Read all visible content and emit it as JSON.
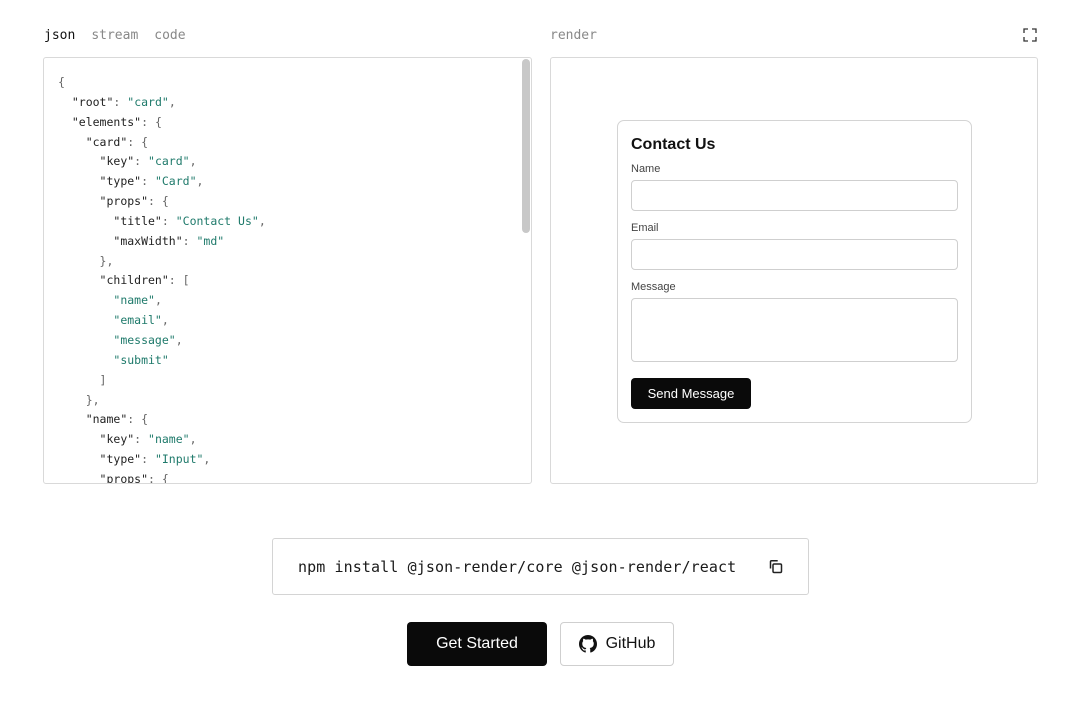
{
  "tabs": [
    {
      "label": "json",
      "active": true
    },
    {
      "label": "stream",
      "active": false
    },
    {
      "label": "code",
      "active": false
    }
  ],
  "render_label": "render",
  "json_lines": [
    [
      [
        "p",
        "{"
      ]
    ],
    [
      [
        "p",
        "  "
      ],
      [
        "k",
        "\"root\""
      ],
      [
        "p",
        ": "
      ],
      [
        "s",
        "\"card\""
      ],
      [
        "p",
        ","
      ]
    ],
    [
      [
        "p",
        "  "
      ],
      [
        "k",
        "\"elements\""
      ],
      [
        "p",
        ": {"
      ]
    ],
    [
      [
        "p",
        "    "
      ],
      [
        "k",
        "\"card\""
      ],
      [
        "p",
        ": {"
      ]
    ],
    [
      [
        "p",
        "      "
      ],
      [
        "k",
        "\"key\""
      ],
      [
        "p",
        ": "
      ],
      [
        "s",
        "\"card\""
      ],
      [
        "p",
        ","
      ]
    ],
    [
      [
        "p",
        "      "
      ],
      [
        "k",
        "\"type\""
      ],
      [
        "p",
        ": "
      ],
      [
        "s",
        "\"Card\""
      ],
      [
        "p",
        ","
      ]
    ],
    [
      [
        "p",
        "      "
      ],
      [
        "k",
        "\"props\""
      ],
      [
        "p",
        ": {"
      ]
    ],
    [
      [
        "p",
        "        "
      ],
      [
        "k",
        "\"title\""
      ],
      [
        "p",
        ": "
      ],
      [
        "s",
        "\"Contact Us\""
      ],
      [
        "p",
        ","
      ]
    ],
    [
      [
        "p",
        "        "
      ],
      [
        "k",
        "\"maxWidth\""
      ],
      [
        "p",
        ": "
      ],
      [
        "s",
        "\"md\""
      ]
    ],
    [
      [
        "p",
        "      },"
      ]
    ],
    [
      [
        "p",
        "      "
      ],
      [
        "k",
        "\"children\""
      ],
      [
        "p",
        ": ["
      ]
    ],
    [
      [
        "p",
        "        "
      ],
      [
        "s",
        "\"name\""
      ],
      [
        "p",
        ","
      ]
    ],
    [
      [
        "p",
        "        "
      ],
      [
        "s",
        "\"email\""
      ],
      [
        "p",
        ","
      ]
    ],
    [
      [
        "p",
        "        "
      ],
      [
        "s",
        "\"message\""
      ],
      [
        "p",
        ","
      ]
    ],
    [
      [
        "p",
        "        "
      ],
      [
        "s",
        "\"submit\""
      ]
    ],
    [
      [
        "p",
        "      ]"
      ]
    ],
    [
      [
        "p",
        "    },"
      ]
    ],
    [
      [
        "p",
        "    "
      ],
      [
        "k",
        "\"name\""
      ],
      [
        "p",
        ": {"
      ]
    ],
    [
      [
        "p",
        "      "
      ],
      [
        "k",
        "\"key\""
      ],
      [
        "p",
        ": "
      ],
      [
        "s",
        "\"name\""
      ],
      [
        "p",
        ","
      ]
    ],
    [
      [
        "p",
        "      "
      ],
      [
        "k",
        "\"type\""
      ],
      [
        "p",
        ": "
      ],
      [
        "s",
        "\"Input\""
      ],
      [
        "p",
        ","
      ]
    ],
    [
      [
        "p",
        "      "
      ],
      [
        "k",
        "\"props\""
      ],
      [
        "p",
        ": {"
      ]
    ]
  ],
  "card": {
    "title": "Contact Us",
    "fields": {
      "name_label": "Name",
      "email_label": "Email",
      "message_label": "Message"
    },
    "submit_label": "Send Message"
  },
  "install": {
    "command": "npm install @json-render/core @json-render/react"
  },
  "buttons": {
    "get_started": "Get Started",
    "github": "GitHub"
  },
  "icons": {
    "expand": "expand-icon",
    "copy": "copy-icon",
    "github": "github-icon"
  },
  "colors": {
    "string": "#1f7a6b",
    "primary_button": "#0a0a0a"
  }
}
